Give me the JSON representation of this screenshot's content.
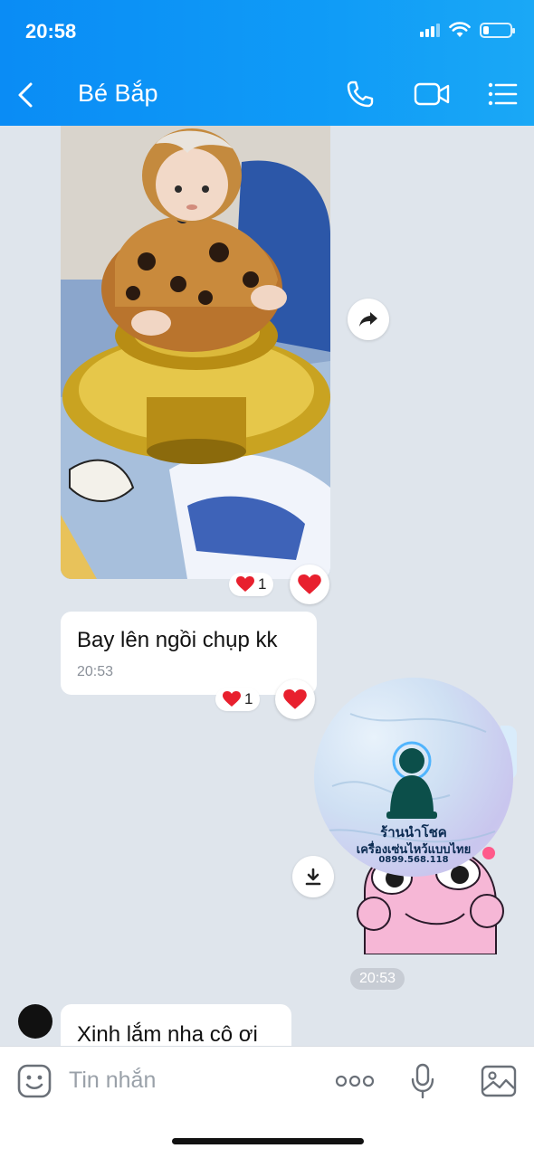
{
  "status_bar": {
    "time": "20:58"
  },
  "header": {
    "title": "Bé Bắp"
  },
  "messages": [
    {
      "type": "image",
      "reaction_count": "1"
    },
    {
      "type": "text",
      "text": "Bay lên ngồi chụp kk",
      "time": "20:53",
      "reaction_count": "1"
    },
    {
      "type": "image_sent"
    },
    {
      "type": "text",
      "text": "Xinh lắm nha cô ơi"
    }
  ],
  "logo": {
    "line1": "ร้านนำโชค",
    "line2": "เครื่องเซ่นไหว้แบบไทย",
    "line3": "0899.568.118"
  },
  "timestamp_chip": "20:53",
  "input": {
    "placeholder": "Tin nhắn"
  },
  "colors": {
    "header": "#0f9bf7",
    "chat_bg": "#dfe5ec",
    "heart": "#e8202e"
  },
  "icons": [
    "back-icon",
    "phone-icon",
    "video-call-icon",
    "menu-icon",
    "share-icon",
    "heart-icon",
    "download-icon",
    "emoji-icon",
    "more-icon",
    "microphone-icon",
    "image-icon"
  ]
}
